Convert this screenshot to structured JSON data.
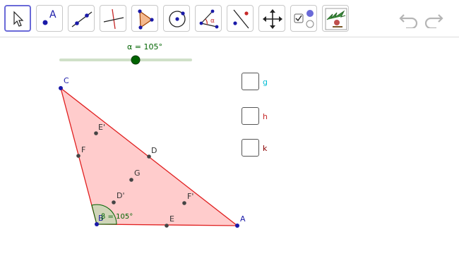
{
  "toolbar": {
    "tools": [
      {
        "name": "move-tool",
        "selected": true
      },
      {
        "name": "point-tool",
        "selected": false,
        "glyph": "A"
      },
      {
        "name": "line-tool",
        "selected": false
      },
      {
        "name": "perpendicular-line-tool",
        "selected": false
      },
      {
        "name": "polygon-tool",
        "selected": false
      },
      {
        "name": "circle-tool",
        "selected": false
      },
      {
        "name": "angle-tool",
        "selected": false,
        "glyph": "α"
      },
      {
        "name": "reflect-tool",
        "selected": false
      },
      {
        "name": "move-graphics-view-tool",
        "selected": false
      },
      {
        "name": "checkbox-tool",
        "selected": false
      },
      {
        "name": "custom-tool",
        "selected": false
      }
    ]
  },
  "slider": {
    "label": "α = 105°"
  },
  "checkboxes": [
    {
      "label": "g",
      "color": "#00bcd4"
    },
    {
      "label": "h",
      "color": "#c62828"
    },
    {
      "label": "k",
      "color": "#8b0000"
    }
  ],
  "points": {
    "A": "A",
    "B": "B",
    "C": "C",
    "D": "D",
    "E": "E",
    "F": "F",
    "G": "G",
    "D_prime": "D'",
    "E_prime": "E'",
    "F_prime": "F'"
  },
  "angle_label": "β = 105°",
  "colors": {
    "accent": "#6a6ad8",
    "triangle_fill": "#ffcccc",
    "triangle_stroke": "#e02020",
    "point": "#1a1aa8",
    "angle": "#006400"
  }
}
